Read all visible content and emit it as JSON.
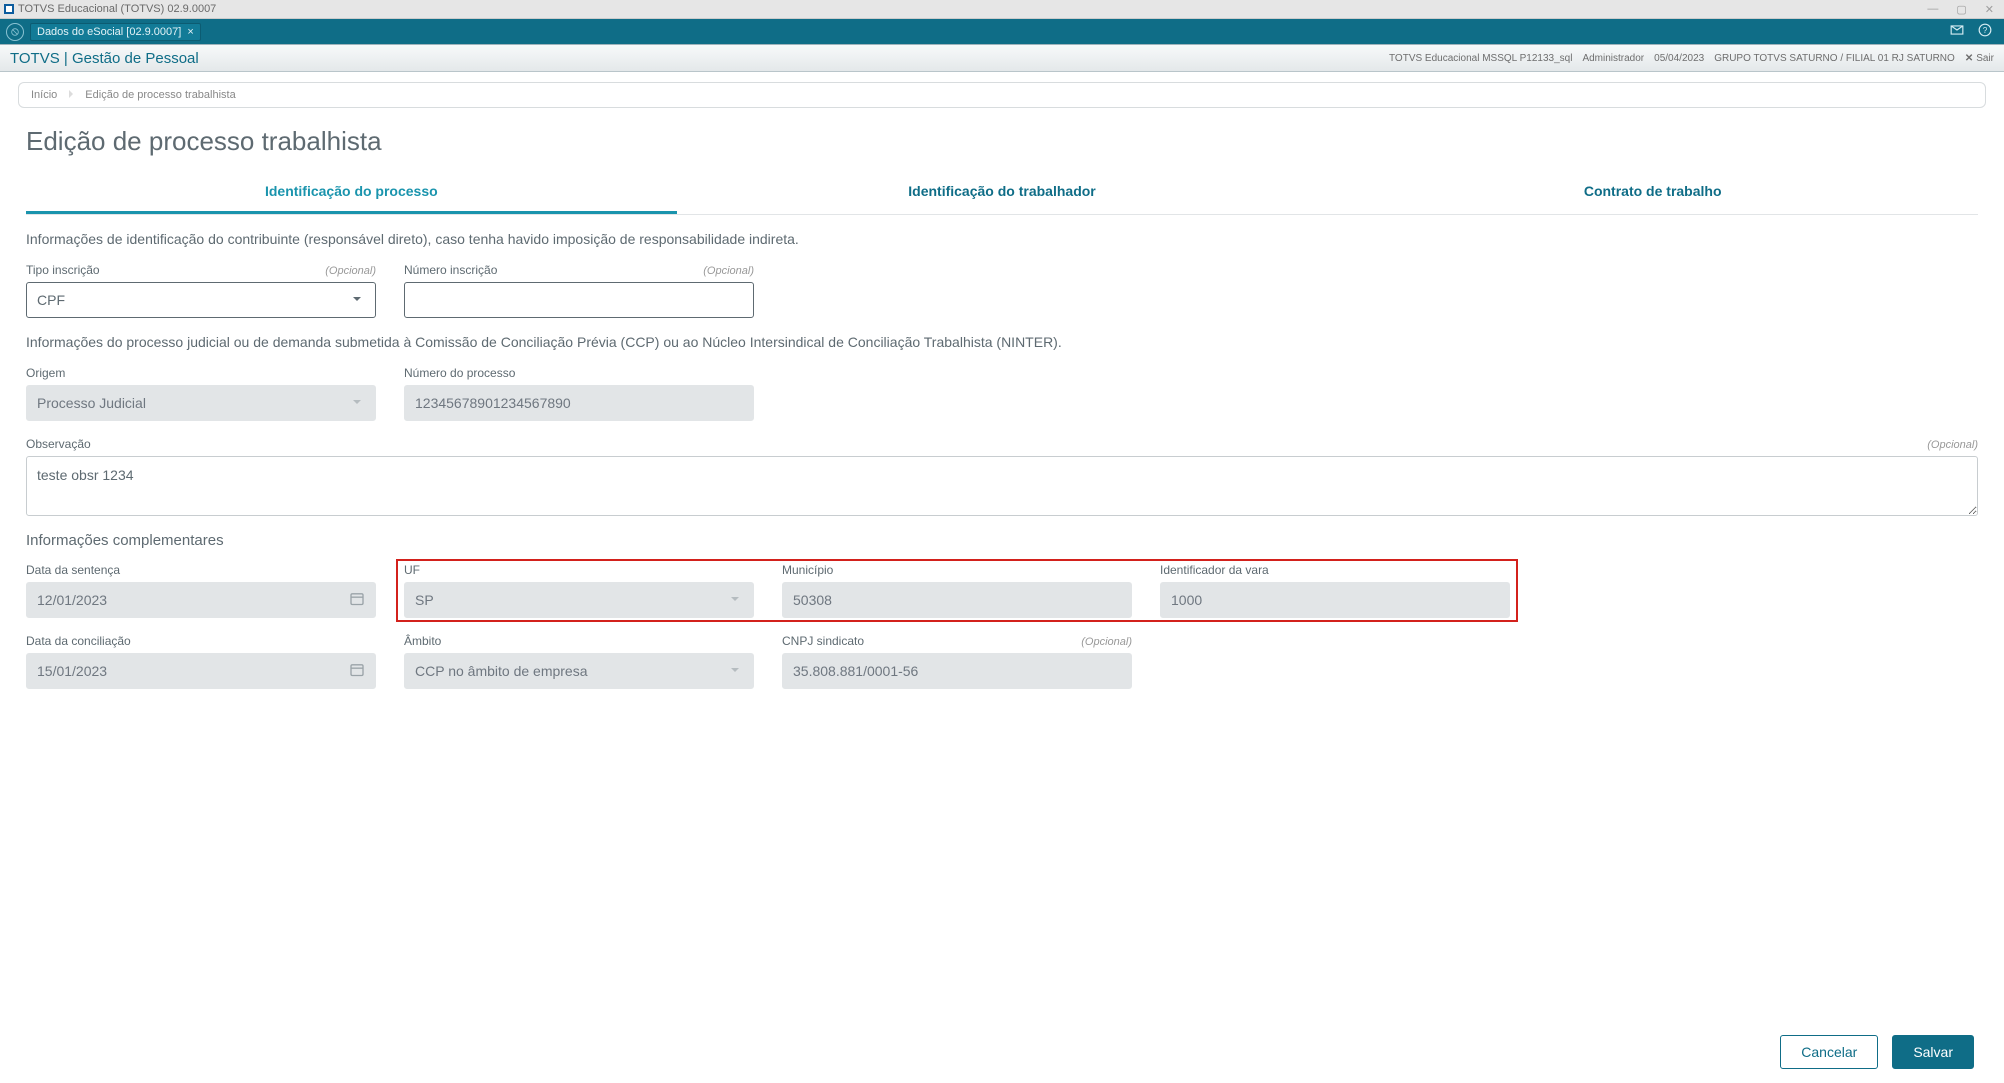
{
  "window": {
    "title": "TOTVS Educacional (TOTVS) 02.9.0007"
  },
  "tealbar": {
    "tab_label": "Dados do eSocial [02.9.0007]"
  },
  "product": {
    "name": "TOTVS | Gestão de Pessoal",
    "env": "TOTVS Educacional MSSQL P12133_sql",
    "user": "Administrador",
    "date": "05/04/2023",
    "group": "GRUPO TOTVS SATURNO / FILIAL 01 RJ SATURNO",
    "sair": "Sair"
  },
  "breadcrumb": {
    "home": "Início",
    "current": "Edição de processo trabalhista"
  },
  "page_title": "Edição de processo trabalhista",
  "tabs": {
    "t1": "Identificação do processo",
    "t2": "Identificação do trabalhador",
    "t3": "Contrato de trabalho"
  },
  "intro1": "Informações de identificação do contribuinte (responsável direto), caso tenha havido imposição de responsabilidade indireta.",
  "tipo_insc": {
    "label": "Tipo inscrição",
    "optional": "(Opcional)",
    "value": "CPF"
  },
  "num_insc": {
    "label": "Número inscrição",
    "optional": "(Opcional)",
    "value": ""
  },
  "intro2": "Informações do processo judicial ou de demanda submetida à Comissão de Conciliação Prévia (CCP) ou ao Núcleo Intersindical de Conciliação Trabalhista (NINTER).",
  "origem": {
    "label": "Origem",
    "value": "Processo Judicial"
  },
  "num_proc": {
    "label": "Número do processo",
    "value": "12345678901234567890"
  },
  "obs": {
    "label": "Observação",
    "optional": "(Opcional)",
    "value": "teste obsr 1234"
  },
  "compl_heading": "Informações complementares",
  "data_sent": {
    "label": "Data da sentença",
    "value": "12/01/2023"
  },
  "uf": {
    "label": "UF",
    "value": "SP"
  },
  "municipio": {
    "label": "Município",
    "value": "50308"
  },
  "vara": {
    "label": "Identificador da vara",
    "value": "1000"
  },
  "data_conc": {
    "label": "Data da conciliação",
    "value": "15/01/2023"
  },
  "ambito": {
    "label": "Âmbito",
    "value": "CCP no âmbito de empresa"
  },
  "cnpj": {
    "label": "CNPJ sindicato",
    "optional": "(Opcional)",
    "value": "35.808.881/0001-56"
  },
  "buttons": {
    "cancel": "Cancelar",
    "save": "Salvar"
  }
}
